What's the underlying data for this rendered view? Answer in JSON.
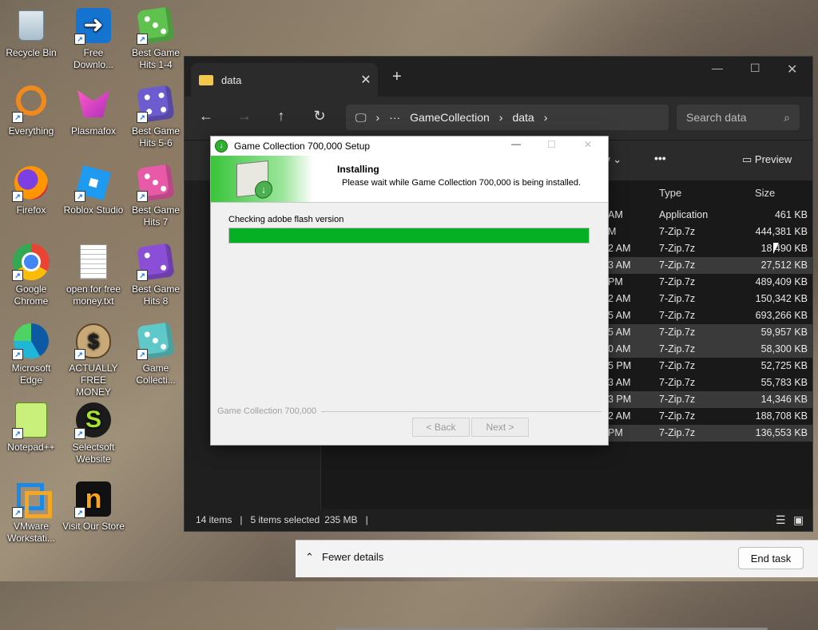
{
  "desktop": {
    "icons": [
      {
        "label": "Recycle Bin"
      },
      {
        "label": "Free Downlo..."
      },
      {
        "label": "Best Game Hits 1-4"
      },
      {
        "label": "Everything"
      },
      {
        "label": "Plasmafox"
      },
      {
        "label": "Best Game Hits 5-6"
      },
      {
        "label": "Firefox"
      },
      {
        "label": "Roblox Studio"
      },
      {
        "label": "Best Game Hits 7"
      },
      {
        "label": "Google Chrome"
      },
      {
        "label": "open for free money.txt"
      },
      {
        "label": "Best Game Hits 8"
      },
      {
        "label": "Microsoft Edge"
      },
      {
        "label": "ACTUALLY FREE MONEY"
      },
      {
        "label": "Game Collecti..."
      },
      {
        "label": "Notepad++"
      },
      {
        "label": "Selectsoft Website"
      },
      {
        "label": "VMware Workstati..."
      },
      {
        "label": "Visit Our Store"
      }
    ]
  },
  "explorer": {
    "tab_title": "data",
    "address": {
      "segment1": "GameCollection",
      "segment2": "data"
    },
    "search_placeholder": "Search data",
    "toolbar": {
      "view_label": "ew",
      "more": "•••",
      "preview_label": "Preview"
    },
    "columns": {
      "type": "Type",
      "size": "Size"
    },
    "rows": [
      {
        "date": "AM",
        "type": "Application",
        "size": "461 KB"
      },
      {
        "date": "M",
        "type": "7-Zip.7z",
        "size": "444,381 KB"
      },
      {
        "date": "2 AM",
        "type": "7-Zip.7z",
        "size": "18,490 KB"
      },
      {
        "date": "3 AM",
        "type": "7-Zip.7z",
        "size": "27,512 KB"
      },
      {
        "date": "PM",
        "type": "7-Zip.7z",
        "size": "489,409 KB"
      },
      {
        "date": "2 AM",
        "type": "7-Zip.7z",
        "size": "150,342 KB"
      },
      {
        "date": "5 AM",
        "type": "7-Zip.7z",
        "size": "693,266 KB"
      },
      {
        "date": "5 AM",
        "type": "7-Zip.7z",
        "size": "59,957 KB"
      },
      {
        "date": "0 AM",
        "type": "7-Zip.7z",
        "size": "58,300 KB"
      },
      {
        "date": "5 PM",
        "type": "7-Zip.7z",
        "size": "52,725 KB"
      },
      {
        "date": "3 AM",
        "type": "7-Zip.7z",
        "size": "55,783 KB"
      },
      {
        "date": "3 PM",
        "type": "7-Zip.7z",
        "size": "14,346 KB"
      },
      {
        "date": "2 AM",
        "type": "7-Zip.7z",
        "size": "188,708 KB"
      },
      {
        "date": "PM",
        "type": "7-Zip.7z",
        "size": "136,553 KB"
      }
    ],
    "status": {
      "items": "14 items",
      "selected": "5 items selected",
      "size": "235 MB"
    }
  },
  "task_manager_footer": {
    "fewer_details": "Fewer details",
    "end_task": "End task"
  },
  "setup": {
    "title": "Game Collection 700,000 Setup",
    "heading": "Installing",
    "subheading": "Please wait while Game Collection 700,000 is being installed.",
    "status_text": "Checking adobe flash version",
    "progress": 1.0,
    "brand": "Game Collection 700,000",
    "back_label": "< Back",
    "next_label": "Next >"
  },
  "colors": {
    "progress": "#06b025",
    "explorer_bg": "#1f1f1f"
  }
}
